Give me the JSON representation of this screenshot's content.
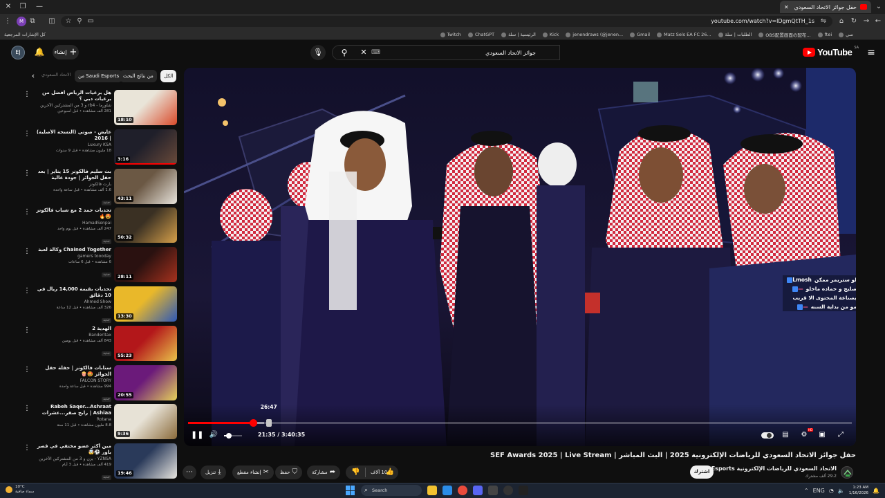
{
  "browser": {
    "tab_title": "حفل جوائز الاتحاد السعودي لل",
    "url": "youtube.com/watch?v=lDgmQtTH_1s",
    "bookmarks": [
      "سي",
      "ftei",
      "OBS配置画面の配布...",
      "الطلبات | سلة",
      "Matz Sels EA FC 26...",
      "Gmail",
      "jenendraws (@jenen...",
      "Kick",
      "الرئيسية | سلة",
      "ChatGPT",
      "Twitch"
    ],
    "bookmarks_all": "كل الإشارات المرجعية"
  },
  "youtube": {
    "logo_text": "YouTube",
    "logo_region": "SA",
    "search_query": "جوائز الاتحاد السعودي",
    "create_label": "إنشاء",
    "avatar_letter": "EJ"
  },
  "chips": {
    "all": "الكل",
    "related": "من نتائج البحث",
    "channel": "من Saudi Esports",
    "fade": "الاتحاد السعودي"
  },
  "related": [
    {
      "title": "هل برغيات الرياض افضل من برغيات دبي ؟",
      "channel": "شاورما - rb4 و 3 من المشتركين الآخرين",
      "stats": "281 ألف مشاهدة • قبل أسبوعين",
      "duration": "18:10",
      "thumb": [
        "#e9e4d8",
        "#d94a2a"
      ],
      "progress": 0
    },
    {
      "title": "عايض - صوتي (النسخة الأصلية) | 2016",
      "channel": "Luxury KSA",
      "stats": "18 مليون مشاهدة • قبل 9 سنوات",
      "duration": "3:16",
      "thumb": [
        "#1f1f2a",
        "#6a4a3a"
      ],
      "progress": 1
    },
    {
      "title": "بث سليم فالكونز 15 يناير | بعد حفل الجوائز | جودة عالية",
      "channel": "بارت فالكونز",
      "stats": "1.6 ألف مشاهدة • قبل ساعة واحدة",
      "duration": "43:11",
      "thumb": [
        "#6b5844",
        "#e8e4dc"
      ],
      "progress": 0,
      "new": "جديد"
    },
    {
      "title": "تحديات حمد 2 مع شباب فالكونز 🤩🔥",
      "channel": "HamadSenpai",
      "stats": "247 ألف مشاهدة • قبل يوم واحد",
      "duration": "50:32",
      "thumb": [
        "#3a3023",
        "#d6a04a"
      ],
      "progress": 0,
      "new": "جديد"
    },
    {
      "title": "Chained Together وكالة لعبة",
      "channel": "gamers toooday",
      "stats": "6 مشاهدة • قبل 6 ساعات",
      "duration": "28:11",
      "thumb": [
        "#2a1110",
        "#a7321e"
      ],
      "progress": 0,
      "new": "جديد"
    },
    {
      "title": "تحديات بقيمة 14,000 ريال في 10 دقائق",
      "channel": "Ahmed Show",
      "stats": "326 ألف مشاهدة • قبل 12 ساعة",
      "duration": "13:30",
      "thumb": [
        "#e9b82a",
        "#2d58b8"
      ],
      "progress": 0,
      "new": "جديد"
    },
    {
      "title": "الهدية 2",
      "channel": "Banderitax",
      "stats": "843 ألف مشاهدة • قبل يومين",
      "duration": "55:23",
      "thumb": [
        "#b3171a",
        "#e9c24a"
      ],
      "progress": 0,
      "new": "جديد"
    },
    {
      "title": "سنابات فالكونز | حفلة حفل الجوائز 🤩🍿",
      "channel": "FALCON STORY",
      "stats": "994 مشاهدة • قبل ساعة واحدة",
      "duration": "20:55",
      "thumb": [
        "#6b1a7a",
        "#e7d15a"
      ],
      "progress": 0,
      "new": "جديد"
    },
    {
      "title": "Rabeh Saqer...Ashraat Ashiaa | رابح صقر...عشرات الاشياء",
      "channel": "Rotana",
      "stats": "8.8 مليون مشاهدة • قبل 11 سنة",
      "duration": "9:36",
      "thumb": [
        "#e7e2d6",
        "#8a6a3a"
      ],
      "progress": 0
    },
    {
      "title": "مين أكثر عضو مختفي في قصر باور ⚽🤯",
      "channel": "YZNSA - يزن و 3 من المشتركين الآخرين",
      "stats": "419 ألف مشاهدة • قبل 3 أيام",
      "duration": "19:46",
      "thumb": [
        "#2a3a5a",
        "#e8e6e0"
      ],
      "progress": 0,
      "new": "جديد"
    }
  ],
  "player": {
    "current_time": "21:35",
    "duration": "3:40:35",
    "time_display": "21:35 / 3:40:35",
    "hover_time": "26:47",
    "played_fraction": 0.098,
    "buffer_fraction": 0.115,
    "hover_fraction": 0.1216,
    "volume_fraction": 0.25,
    "hd_badge": "HD",
    "chat": [
      {
        "user": "Lmosh",
        "text": "لو ستريمر ممكن",
        "pink": false
      },
      {
        "user": "—",
        "text": "صليح و حماده ماخلو",
        "pink": true
      },
      {
        "user": "",
        "text": "بصناعة المحتوى الا قريب",
        "pink": false
      },
      {
        "user": "—",
        "text": "مو من بداية السنه",
        "pink": true
      }
    ]
  },
  "video": {
    "title": "حفل جوائز الاتحاد السعودي للرياضات الإلكترونية 2025 | البث المباشر | SEF Awards 2025 | Live Stream",
    "channel_name": "الاتحاد السعودي للرياضات الإلكترونية Saudi Esports",
    "channel_subs": "29.2 ألف مشترك",
    "subscribe_label": "اشترك",
    "actions": {
      "likes": "10 آلاف",
      "share": "مشاركة",
      "save": "حفظ",
      "clip": "إنشاء مقطع",
      "download": "تنزيل"
    }
  },
  "taskbar": {
    "temp": "10°C",
    "weather": "سماء صافية",
    "search": "Search",
    "time": "1:23 AM",
    "date": "1/16/2026",
    "lang": "ENG"
  },
  "colors": {
    "yt_red": "#ff0000",
    "bg": "#0f0f0f",
    "chip_bg": "#272727"
  }
}
